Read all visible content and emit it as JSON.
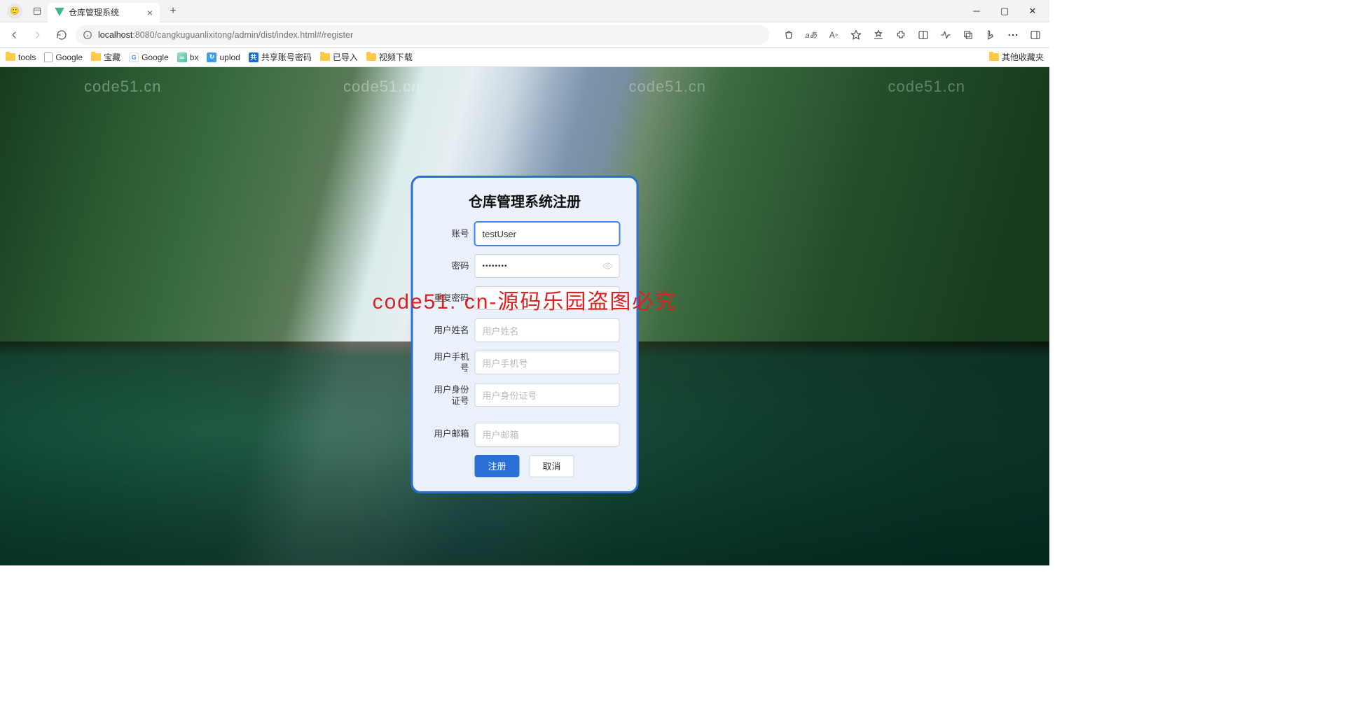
{
  "browser": {
    "tab_title": "仓库管理系统",
    "url_host": "localhost",
    "url_port_path": ":8080/cangkuguanlixitong/admin/dist/index.html#/register"
  },
  "bookmarks": {
    "b1": "tools",
    "b2": "Google",
    "b3": "宝藏",
    "b4": "Google",
    "b5": "bx",
    "b6": "uplod",
    "b7": "共享账号密码",
    "b8": "已导入",
    "b9": "视频下载",
    "other": "其他收藏夹"
  },
  "watermark": {
    "text": "code51.cn",
    "red": "code51. cn-源码乐园盗图必究"
  },
  "form": {
    "title": "仓库管理系统注册",
    "account_label": "账号",
    "account_value": "testUser",
    "password_label": "密码",
    "password_value": "••••••••",
    "confirm_label": "重复密码",
    "confirm_value": "",
    "name_label": "用户姓名",
    "name_placeholder": "用户姓名",
    "phone_label": "用户手机号",
    "phone_placeholder": "用户手机号",
    "idcard_label": "用户身份证号",
    "idcard_placeholder": "用户身份证号",
    "email_label": "用户邮箱",
    "email_placeholder": "用户邮箱",
    "submit": "注册",
    "cancel": "取消"
  }
}
